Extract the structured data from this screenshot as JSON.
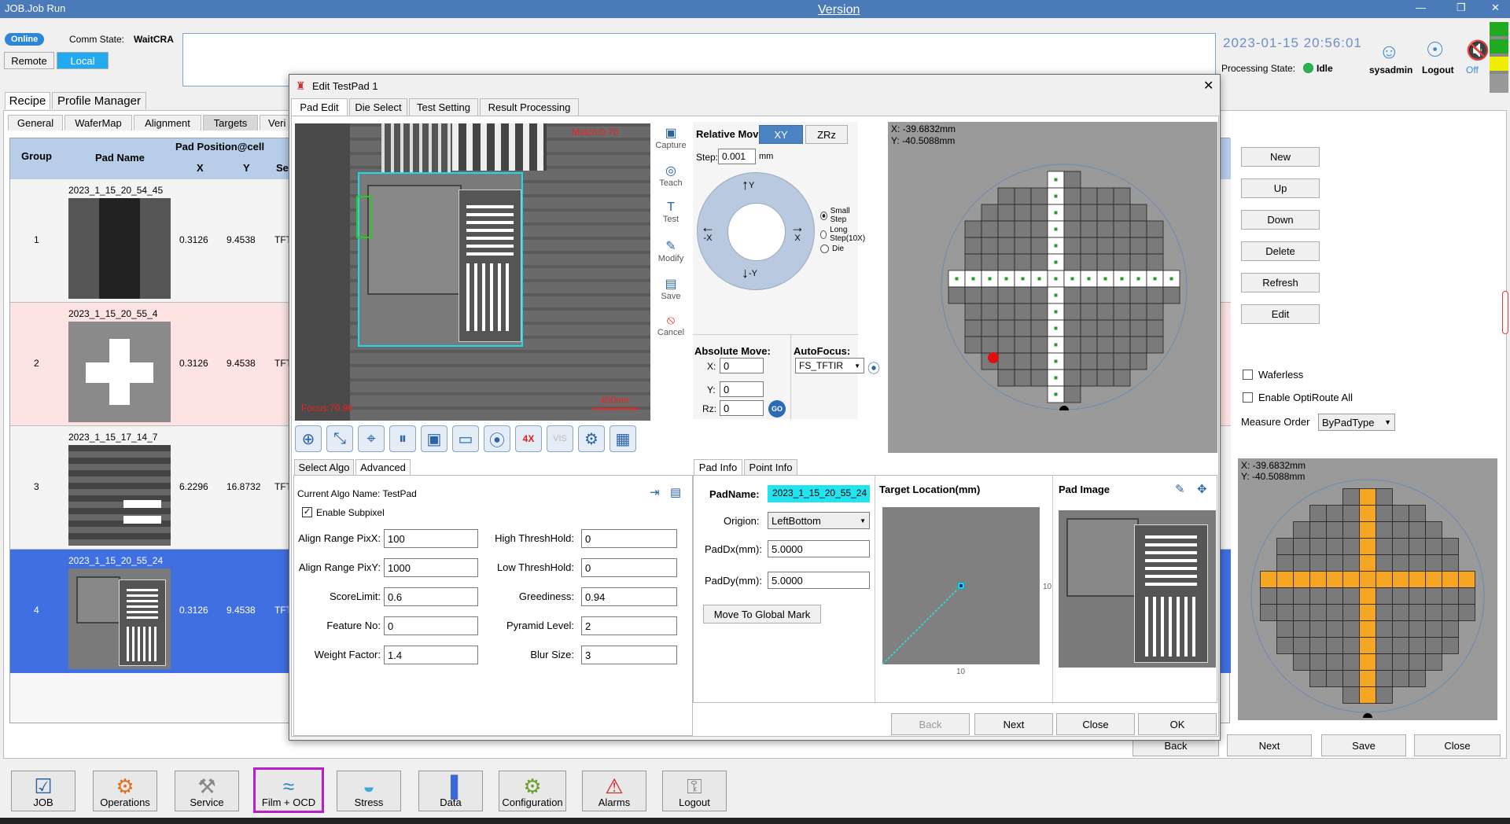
{
  "titlebar": {
    "title": "JOB.Job Run",
    "version": "Version"
  },
  "status": {
    "online": "Online",
    "comm_label": "Comm State:",
    "comm_value": "WaitCRA",
    "remote": "Remote",
    "local": "Local",
    "datetime": "2023-01-15 20:56:01",
    "processing_label": "Processing State:",
    "processing_value": "Idle",
    "user": "sysadmin",
    "logout": "Logout",
    "sound": "Off"
  },
  "main_tabs": [
    "Recipe",
    "Profile Manager"
  ],
  "sub_tabs": [
    "General",
    "WaferMap",
    "Alignment",
    "Targets",
    "Veri"
  ],
  "table": {
    "headers": {
      "group": "Group",
      "pad_name": "Pad Name",
      "pad_pos": "Pad Position@cell",
      "x": "X",
      "y": "Y",
      "sen": "Sen"
    },
    "rows": [
      {
        "group": "1",
        "name": "2023_1_15_20_54_45",
        "x": "0.3126",
        "y": "9.4538",
        "sen": "TFT"
      },
      {
        "group": "2",
        "name": "2023_1_15_20_55_4",
        "x": "0.3126",
        "y": "9.4538",
        "sen": "TFT"
      },
      {
        "group": "3",
        "name": "2023_1_15_17_14_7",
        "x": "6.2296",
        "y": "16.8732",
        "sen": "TFT"
      },
      {
        "group": "4",
        "name": "2023_1_15_20_55_24",
        "x": "0.3126",
        "y": "9.4538",
        "sen": "TFT"
      }
    ]
  },
  "right_buttons": [
    "New",
    "Up",
    "Down",
    "Delete",
    "Refresh",
    "Edit"
  ],
  "right_options": {
    "waferless": "Waferless",
    "optiroute": "Enable OptiRoute All",
    "measure_order_label": "Measure Order",
    "measure_order_value": "ByPadType"
  },
  "right_coords": {
    "x": "X: -39.6832mm",
    "y": "Y: -40.5088mm"
  },
  "bottom_nav": {
    "back": "Back",
    "next": "Next",
    "save": "Save",
    "close": "Close"
  },
  "taskbar": [
    "JOB",
    "Operations",
    "Service",
    "Film + OCD",
    "Stress",
    "Data",
    "Configuration",
    "Alarms",
    "Logout"
  ],
  "dialog": {
    "title": "Edit TestPad 1",
    "tabs": [
      "Pad Edit",
      "Die Select",
      "Test Setting",
      "Result Processing"
    ],
    "image": {
      "match": "Match:0.70",
      "focus": "Focus:70.96",
      "scale": "400nm"
    },
    "side_tools": [
      "Capture",
      "Teach",
      "Test",
      "Modify",
      "Save",
      "Cancel"
    ],
    "relative_move": "Relative Move:",
    "xy": "XY",
    "zrz": "ZRz",
    "step_label": "Step:",
    "step_value": "0.001",
    "step_unit": "mm",
    "dirs": {
      "up": "Y",
      "down": "-Y",
      "left": "-X",
      "right": "X"
    },
    "step_opts": [
      "Small Step",
      "Long Step(10X)",
      "Die"
    ],
    "abs_move": "Absolute Move:",
    "abs_x": "0",
    "abs_y": "0",
    "abs_rz": "0",
    "go": "GO",
    "autofocus": "AutoFocus:",
    "af_value": "FS_TFTIR",
    "map_coords": {
      "x": "X: -39.6832mm",
      "y": "Y: -40.5088mm"
    },
    "algo_tabs": [
      "Select Algo",
      "Advanced"
    ],
    "algo_name": "Current Algo Name: TestPad",
    "subpixel": "Enable Subpixel",
    "left_params": [
      {
        "label": "Align Range PixX:",
        "value": "100"
      },
      {
        "label": "Align Range PixY:",
        "value": "1000"
      },
      {
        "label": "ScoreLimit:",
        "value": "0.6"
      },
      {
        "label": "Feature No:",
        "value": "0"
      },
      {
        "label": "Weight Factor:",
        "value": "1.4"
      }
    ],
    "right_params": [
      {
        "label": "High ThreshHold:",
        "value": "0"
      },
      {
        "label": "Low ThreshHold:",
        "value": "0"
      },
      {
        "label": "Greediness:",
        "value": "0.94"
      },
      {
        "label": "Pyramid Level:",
        "value": "2"
      },
      {
        "label": "Blur Size:",
        "value": "3"
      }
    ],
    "info_tabs": [
      "Pad Info",
      "Point Info"
    ],
    "padname_label": "PadName:",
    "padname_value": "2023_1_15_20_55_24",
    "origin_label": "Origion:",
    "origin_value": "LeftBottom",
    "paddx_label": "PadDx(mm):",
    "paddx_value": "5.0000",
    "paddy_label": "PadDy(mm):",
    "paddy_value": "5.0000",
    "move_global": "Move To Global Mark",
    "target_loc": "Target Location(mm)",
    "axis10a": "10",
    "axis10b": "10",
    "pad_image": "Pad Image",
    "footer": [
      "Back",
      "Next",
      "Close",
      "OK"
    ]
  }
}
